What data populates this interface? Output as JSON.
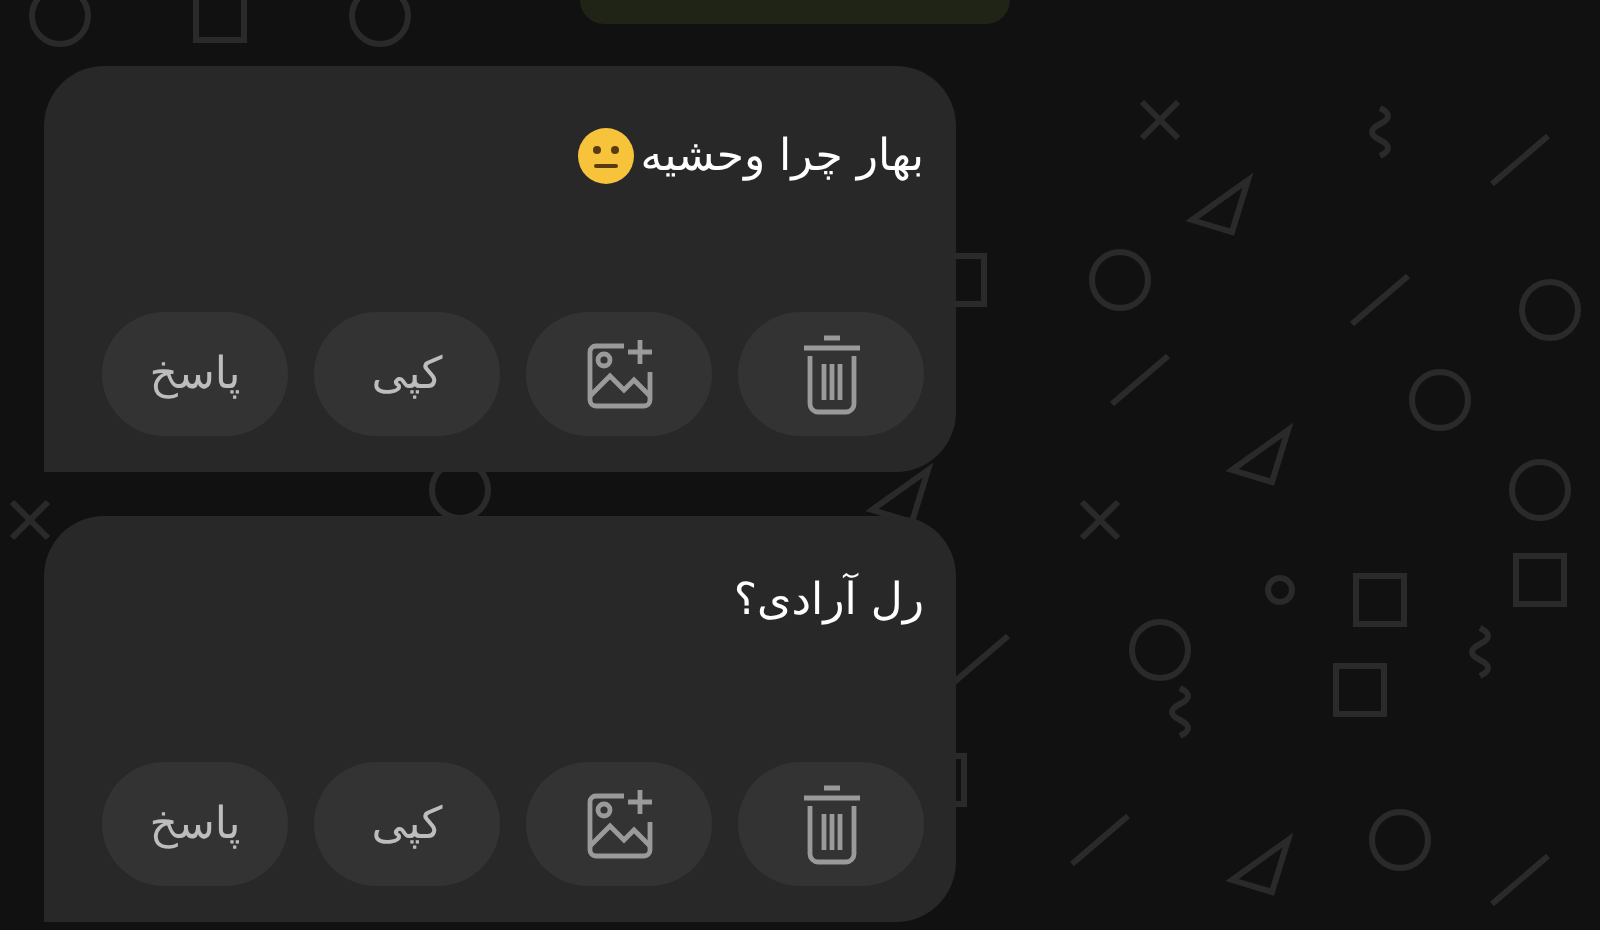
{
  "messages": [
    {
      "text": "بهار چرا وحشیه",
      "emoji": true,
      "actions": [
        {
          "kind": "delete"
        },
        {
          "kind": "add-image"
        },
        {
          "kind": "text",
          "label": "کپی"
        },
        {
          "kind": "text",
          "label": "پاسخ"
        }
      ]
    },
    {
      "text": "رل آرادی؟",
      "emoji": false,
      "actions": [
        {
          "kind": "delete"
        },
        {
          "kind": "add-image"
        },
        {
          "kind": "text",
          "label": "کپی"
        },
        {
          "kind": "text",
          "label": "پاسخ"
        }
      ]
    }
  ]
}
